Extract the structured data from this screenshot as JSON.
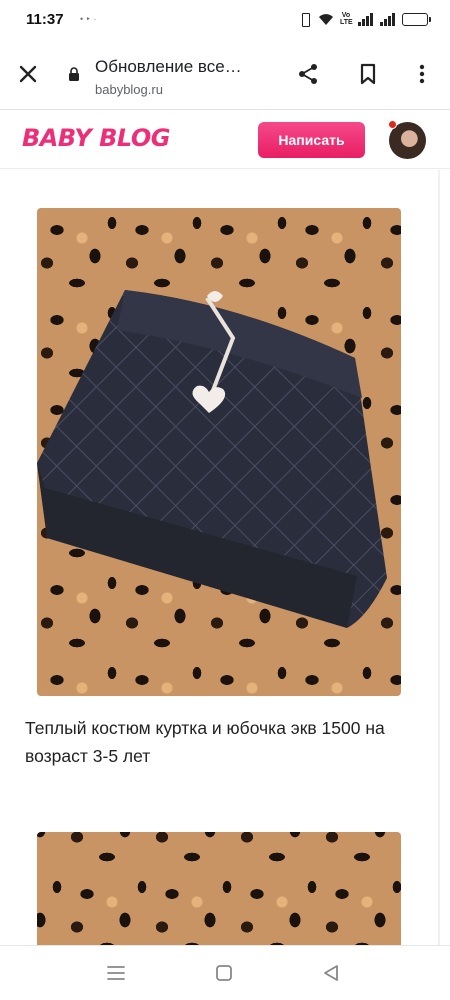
{
  "status_bar": {
    "time": "11:37",
    "notification_dots": "• ‣ ·",
    "volte_label": "Vo\nLTE",
    "battery_level": 0.85
  },
  "browser": {
    "page_title": "Обновление все…",
    "url": "babyblog.ru",
    "icons": [
      "close-icon",
      "lock-icon",
      "share-icon",
      "bookmark-icon",
      "more-vert-icon"
    ]
  },
  "site_header": {
    "logo_text": "BABY BLOG",
    "write_button_label": "Написать",
    "accent_color": "#ec2f78",
    "notification_dot_color": "#e0281b"
  },
  "post": {
    "caption": "Теплый костюм куртка и юбочка экв 1500 на возраст 3-5 лет"
  },
  "navigation": {
    "icons": [
      "recent-apps-icon",
      "home-icon",
      "back-icon"
    ]
  }
}
